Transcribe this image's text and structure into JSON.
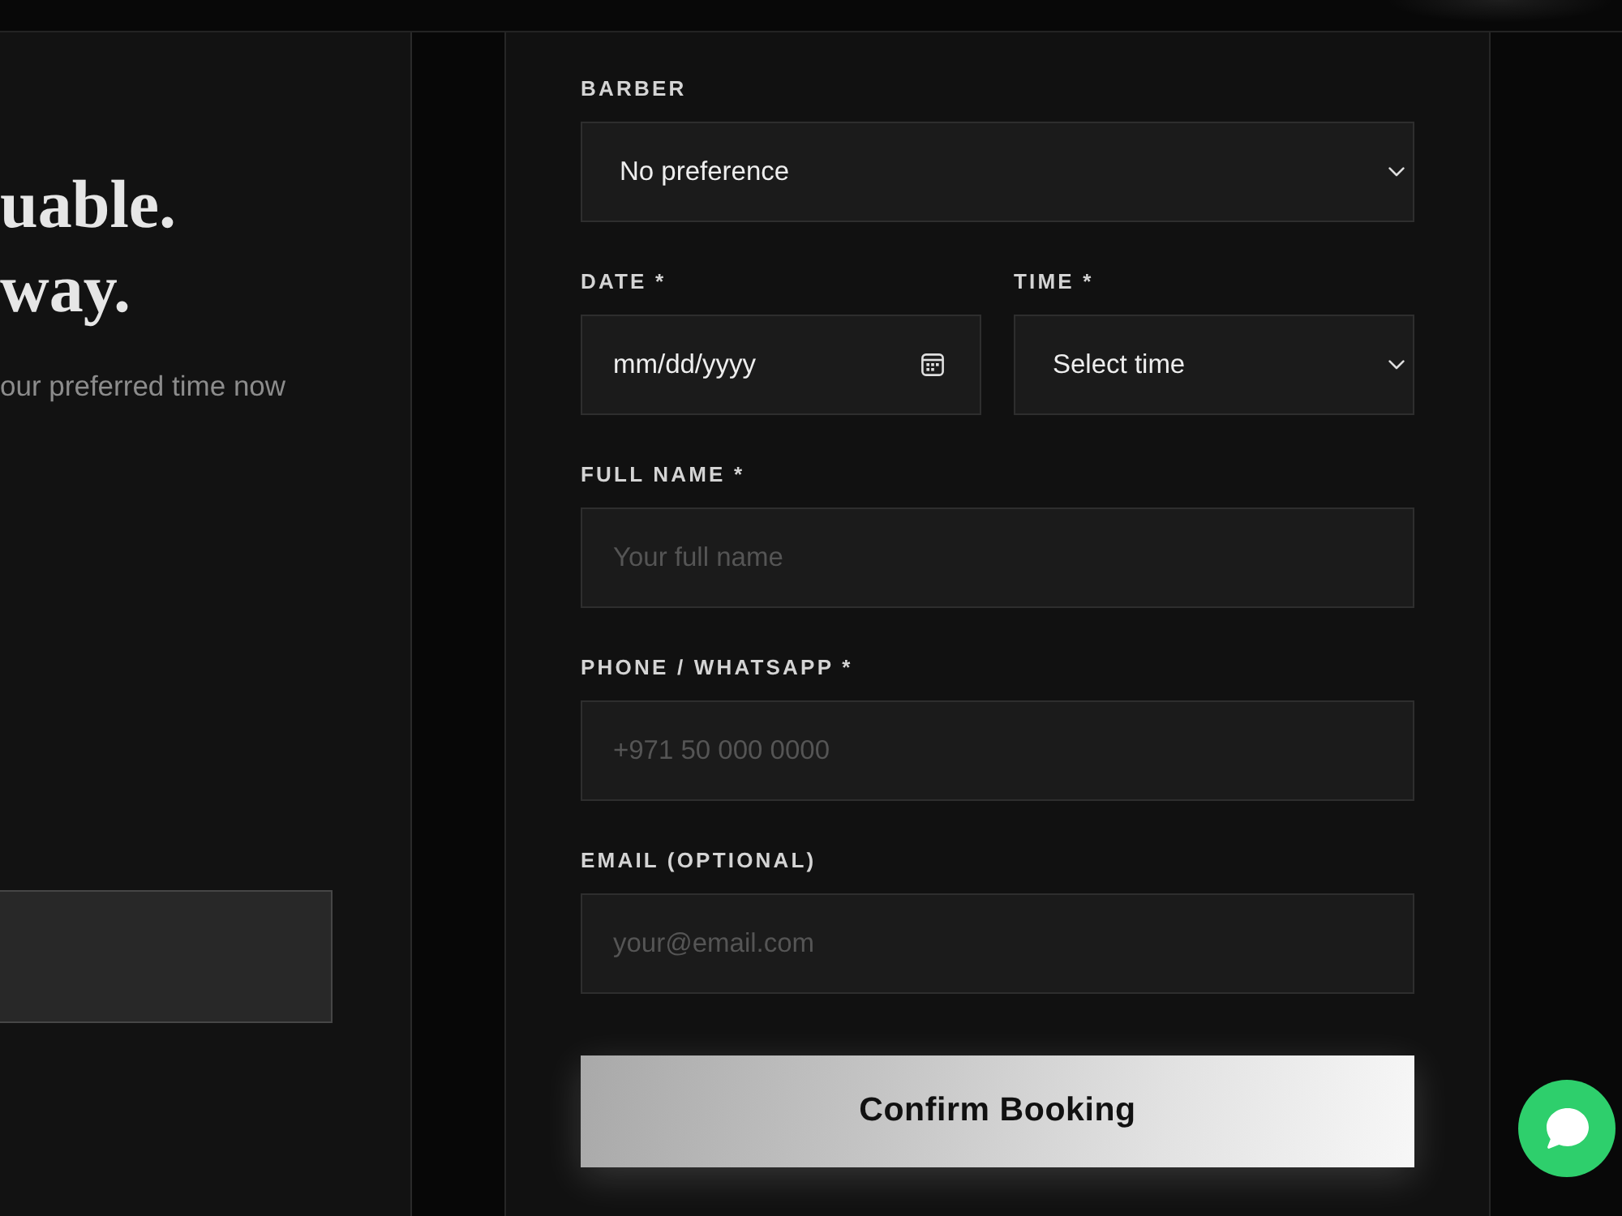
{
  "hero": {
    "heading_lines": [
      "uable.",
      "way."
    ],
    "subtitle": "our preferred time now"
  },
  "booking_form": {
    "rows": [
      [
        {
          "kind": "select",
          "label": "BARBER",
          "value": "No preference"
        }
      ],
      [
        {
          "kind": "date",
          "label": "DATE *",
          "placeholder": "mm/dd/yyyy"
        },
        {
          "kind": "select",
          "label": "TIME *",
          "value": "Select time"
        }
      ],
      [
        {
          "kind": "text",
          "label": "FULL NAME *",
          "placeholder": "Your full name"
        }
      ],
      [
        {
          "kind": "text",
          "label": "PHONE / WHATSAPP *",
          "placeholder": "+971 50 000 0000"
        }
      ],
      [
        {
          "kind": "text",
          "label": "EMAIL (OPTIONAL)",
          "placeholder": "your@email.com"
        }
      ]
    ],
    "submit_button": {
      "label": "Confirm Booking"
    }
  }
}
